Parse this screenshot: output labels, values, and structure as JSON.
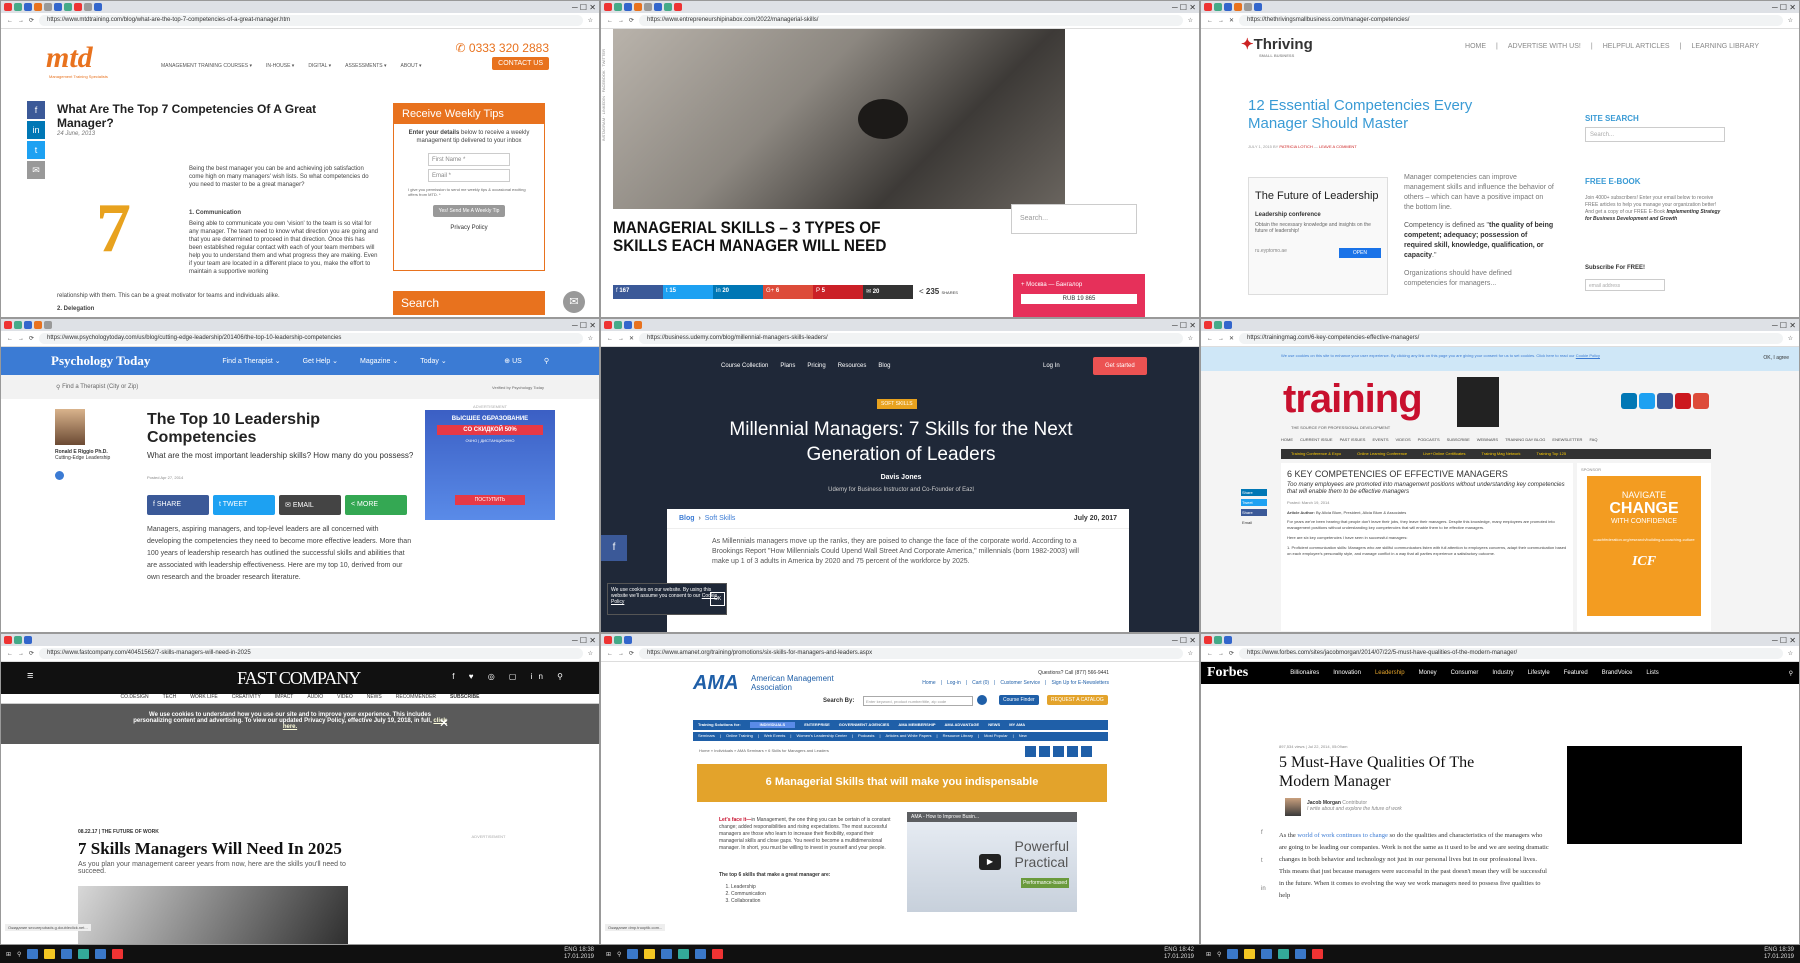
{
  "screens": [
    {
      "url": "https://www.mtdtraining.com/blog/what-are-the-top-7-competencies-of-a-great-manager.htm",
      "brand": "mtd",
      "tagline": "Management Training Specialists",
      "phone": "0333 320 2883",
      "nav": [
        "MANAGEMENT TRAINING COURSES ▾",
        "IN-HOUSE ▾",
        "DIGITAL ▾",
        "ASSESSMENTS ▾",
        "ABOUT ▾"
      ],
      "contact": "CONTACT US",
      "title": "What Are The Top 7 Competencies Of A Great Manager?",
      "date": "24 June, 2013",
      "intro": "Being the best manager you can be and achieving job satisfaction come high on many managers' wish lists. So what competencies do you need to master to be a great manager?",
      "sec1": "1. Communication",
      "body1": "Being able to communicate you own 'vision' to the team is so vital for any manager. The team need to know what direction you are going and that you are determined to proceed in that direction. Once this has been established regular contact with each of your team members will help you to understand them and what progress they are making. Even if your team are located in a different place to you, make the effort to maintain a supportive working",
      "body1b": "relationship with them. This can be a great motivator for teams and individuals alike.",
      "sec2": "2. Delegation",
      "tips_title": "Receive Weekly Tips",
      "tips_text_bold": "Enter your details",
      "tips_text": "below to receive a weekly management tip delivered to your inbox",
      "first_name": "First Name *",
      "email": "Email *",
      "consent": "I give you permission to send me weekly tips & occasional exciting offers from MTD. *",
      "tips_button": "Yes! Send Me A Weekly Tip",
      "privacy": "Privacy Policy",
      "search": "Search",
      "big_number": "7"
    },
    {
      "url": "https://www.entrepreneurshipinabox.com/2022/managerial-skills/",
      "title": "MANAGERIAL SKILLS – 3 TYPES OF SKILLS EACH MANAGER WILL NEED",
      "share_counts": [
        "167",
        "15",
        "20",
        "6",
        "5",
        "20"
      ],
      "share_total": "235",
      "share_total_label": "SHARES",
      "search": "Search...",
      "ad_text": "+ Москва — Бангалор",
      "ad_price": "RUB 19 865",
      "side_tabs": [
        "INSTAGRAM",
        "LINKEDIN",
        "FACEBOOK",
        "TWITTER"
      ]
    },
    {
      "url": "https://thethrivingsmallbusiness.com/manager-competencies/",
      "brand": "Thriving",
      "brand_sub": "SMALL BUSINESS",
      "nav": [
        "HOME",
        "ADVERTISE WITH US!",
        "HELPFUL ARTICLES",
        "LEARNING LIBRARY"
      ],
      "title": "12 Essential Competencies Every Manager Should Master",
      "meta_prefix": "JULY 1, 2015 BY",
      "author": "PATRICIA LOTICH",
      "leave_comment": "LEAVE A COMMENT",
      "ad_title": "The Future of Leadership",
      "ad_sub": "Leadership conference",
      "ad_desc": "Obtain the necessary knowledge and insights on the future of leadership!",
      "ad_domain": "ru.eyptomo.ae",
      "ad_open": "OPEN",
      "p1": "Manager competencies can improve management skills and influence the behavior of others – which can have a positive impact on the bottom line.",
      "p2a": "Competency is defined as \"",
      "p2b": "the quality of being competent; adequacy; possession of required skill, knowledge, qualification, or capacity",
      "p2c": ".\"",
      "p3": "Organizations should have defined competencies for managers...",
      "site_search": "SITE SEARCH",
      "search_ph": "Search...",
      "ebook": "FREE E-BOOK",
      "ebook_text": "Join 4000+ subscribers! Enter your email below to receive FREE articles to help you manage your organization better! And get a copy of our FREE E-Book",
      "ebook_bold": "Implementing Strategy for Business Development and Growth",
      "subscribe": "Subscribe For FREE!",
      "email_ph": "email address"
    },
    {
      "url": "https://www.psychologytoday.com/us/blog/cutting-edge-leadership/201406/the-top-10-leadership-competencies",
      "brand": "Psychology Today",
      "nav": [
        "Find a Therapist ⌄",
        "Get Help ⌄",
        "Magazine ⌄",
        "Today ⌄"
      ],
      "region": "US",
      "find_ph": "Find a Therapist (City or Zip)",
      "verified": "Verified by Psychology Today",
      "author": "Ronald E Riggio Ph.D.",
      "blog": "Cutting-Edge Leadership",
      "title": "The Top 10 Leadership Competencies",
      "subtitle": "What are the most important leadership skills? How many do you possess?",
      "posted": "Posted Apr 27, 2014",
      "share": [
        "SHARE",
        "TWEET",
        "EMAIL",
        "MORE"
      ],
      "body": "Managers, aspiring managers, and top-level leaders are all concerned with developing the competencies they need to become more effective leaders. More than 100 years of leadership research has outlined the successful skills and abilities that are associated with leadership effectiveness. Here are my top 10, derived from our own research and the broader research literature.",
      "ad_label": "ADVERTISEMENT",
      "ad_line1": "ВЫСШЕЕ ОБРАЗОВАНИЕ",
      "ad_line2": "СО СКИДКОЙ 50%",
      "ad_line3": "ОЧНО | ДИСТАНЦИОННО",
      "ad_cta": "ПОСТУПИТЬ"
    },
    {
      "url": "https://business.udemy.com/blog/millennial-managers-skills-leaders/",
      "nav": [
        "Course Collection",
        "Plans",
        "Pricing",
        "Resources",
        "Blog"
      ],
      "login": "Log In",
      "cta": "Get started",
      "tag": "SOFT SKILLS",
      "title": "Millennial Managers: 7 Skills for the Next Generation of Leaders",
      "author": "Davis Jones",
      "author_role": "Udemy for Business Instructor and Co-Founder of Eazl",
      "crumb_blog": "Blog",
      "crumb_sep": "›",
      "crumb_cat": "Soft Skills",
      "date": "July 20, 2017",
      "body": "As Millennials managers move up the ranks, they are poised to change the face of the corporate world. According to a Brookings Report \"How Millennials Could Upend Wall Street And Corporate America,\" millennials (born 1982-2003) will make up 1 of 3 adults in America by 2020 and 75 percent of the workforce by 2025.",
      "cookie": "We use cookies on our website. By using this website we'll assume you consent to our",
      "cookie_link": "Cookie Policy",
      "cookie_ok": "OK"
    },
    {
      "url": "https://trainingmag.com/6-key-competencies-effective-managers/",
      "cookie": "We use cookies on this site to enhance your user experience. By clicking any link on this page you are giving your consent for us to set cookies. Click here to read our",
      "cookie_link": "Cookie Policy",
      "agree": "OK, I agree",
      "brand": "training",
      "brand_sub": "THE SOURCE FOR PROFESSIONAL DEVELOPMENT",
      "nav": [
        "HOME",
        "CURRENT ISSUE",
        "PAST ISSUES",
        "EVENTS",
        "VIDEOS",
        "PODCASTS",
        "SUBSCRIBE",
        "WEBINARS",
        "TRAINING DAY BLOG",
        "ENEWSLETTER",
        "FAQ"
      ],
      "subnav": [
        "Training Conference & Expo",
        "Online Learning Conference",
        "Live+Online Certificates",
        "Training Mag Network",
        "Training Top 125"
      ],
      "title": "6 KEY COMPETENCIES OF EFFECTIVE MANAGERS",
      "dek": "Too many employees are promoted into management positions without understanding key competencies that will enable them to be effective managers",
      "posted": "Posted: March 19, 2014",
      "author_label": "Article Author:",
      "author": "By Alicia Blum, President, Alicia Blum & Associates",
      "p1": "For years we've been hearing that people don't leave their jobs, they leave their managers. Despite this knowledge, many employees are promoted into management positions without understanding key competencies that will enable them to be effective managers.",
      "p2": "Here are six key competencies I have seen in successful managers:",
      "p3": "1. Proficient communication skills: Managers who are skillful communicators listen with full attention to employees concerns, adapt their communication based on each employee's personality style, and manage conflict in a way that all parties experience a satisfactory outcome.",
      "sponsor": "SPONSOR",
      "ad1": "NAVIGATE",
      "ad2": "CHANGE",
      "ad3": "WITH CONFIDENCE",
      "ad4": "coachfederation.org/research/building-a-coaching-culture",
      "ad5": "ICF",
      "shares": [
        "Share",
        "Tweet",
        "Share",
        "Email"
      ]
    },
    {
      "url": "https://www.fastcompany.com/40451562/7-skills-managers-will-need-in-2025",
      "brand": "FAST COMPANY",
      "nav": [
        "CO.DESIGN",
        "TECH",
        "WORK LIFE",
        "CREATIVITY",
        "IMPACT",
        "AUDIO",
        "VIDEO",
        "NEWS",
        "RECOMMENDER",
        "SUBSCRIBE"
      ],
      "cookie": "We use cookies to understand how you use our site and to improve your experience. This includes personalizing content and advertising. To view our updated Privacy Policy, effective July 19, 2018, in full,",
      "cookie_link": "click here.",
      "kicker": "08.22.17 | THE FUTURE OF WORK",
      "title": "7 Skills Managers Will Need In 2025",
      "dek": "As you plan your management career years from now, here are the skills you'll need to succeed.",
      "ad_label": "ADVERTISEMENT",
      "status": "Ожидание securepubads.g.doubleclick.net..."
    },
    {
      "url": "https://www.amanet.org/training/promotions/six-skills-for-managers-and-leaders.aspx",
      "brand": "AMA",
      "brand_full": "American Management Association",
      "questions": "Questions? Call (877) 566-9441",
      "toplinks": [
        "Home",
        "Log-in",
        "Cart (0)",
        "Customer Service",
        "Sign Up for E-Newsletters"
      ],
      "search_label": "Search By:",
      "search_ph": "Enter keyword, product number/title, zip code",
      "course_finder": "Course Finder",
      "catalog": "REQUEST A CATALOG",
      "nav": [
        "Training Solutions for:",
        "INDIVIDUALS",
        "ENTERPRISE",
        "GOVERNMENT AGENCIES",
        "AMA MEMBERSHIP",
        "AMA ADVANTAGE",
        "NEWS",
        "MY AMA"
      ],
      "subnav": [
        "Seminars",
        "Online Training",
        "Web Events",
        "Women's Leadership Center",
        "Podcasts",
        "Articles and White Papers",
        "Resource Library",
        "Most Popular",
        "New"
      ],
      "crumbs": "Home » Individuals » AMA Seminars » 6 Skills for Managers and Leaders",
      "banner": "6 Managerial Skills that will make you indispensable",
      "lead": "Let's face it—",
      "body": "in Management, the one thing you can be certain of is constant change; added responsibilities and rising expectations. The most successful managers are those who learn to increase their flexibility, expand their managerial skills and close gaps. You need to become a multidimensional manager. In short, you must be willing to invest in yourself and your people.",
      "list_title": "The top 6 skills that make a great manager are:",
      "list": [
        "Leadership",
        "Communication",
        "Collaboration"
      ],
      "video_title": "AMA - How to Improve Busin...",
      "video_big1": "Powerful",
      "video_big2": "Practical",
      "video_big3": "Performance-based",
      "status": "Ожидание dmp.truoptik.com..."
    },
    {
      "url": "https://www.forbes.com/sites/jacobmorgan/2014/07/22/5-must-have-qualities-of-the-modern-manager/",
      "brand": "Forbes",
      "nav": [
        "Billionaires",
        "Innovation",
        "Leadership",
        "Money",
        "Consumer",
        "Industry",
        "Lifestyle",
        "Featured",
        "BrandVoice",
        "Lists"
      ],
      "views": "897,534 views | Jul 22, 2014, 05:09am",
      "title": "5 Must-Have Qualities Of The Modern Manager",
      "author": "Jacob Morgan",
      "author_role": "Contributor",
      "author_bio": "I write about and explore the future of work",
      "p_pre": "As the ",
      "p_link": "world of work continues to change",
      "p_post": " so do the qualities and characteristics of the managers who are going to be leading our companies. Work is not the same as it used to be and we are seeing dramatic changes in both behavior and technology not just in our personal lives but in our professional lives. This means that just because managers were successful in the past doesn't mean they will be successful in the future. When it comes to evolving the way we work managers need to possess five qualities to help"
    }
  ],
  "clocks": [
    {
      "time": "18:38",
      "date": "17.01.2019"
    },
    {
      "time": "18:42",
      "date": "17.01.2019"
    },
    {
      "time": "18:39",
      "date": "17.01.2019"
    }
  ],
  "lang": "ENG",
  "colors": {
    "mtd": "#e8721e",
    "pt": "#3b7bd4",
    "udemy": "#1f2838",
    "udemy_cta": "#ec5252",
    "ama_blue": "#1f5fa8",
    "ama_gold": "#e3a32b",
    "icf": "#f39c21",
    "forbes": "#000000"
  }
}
